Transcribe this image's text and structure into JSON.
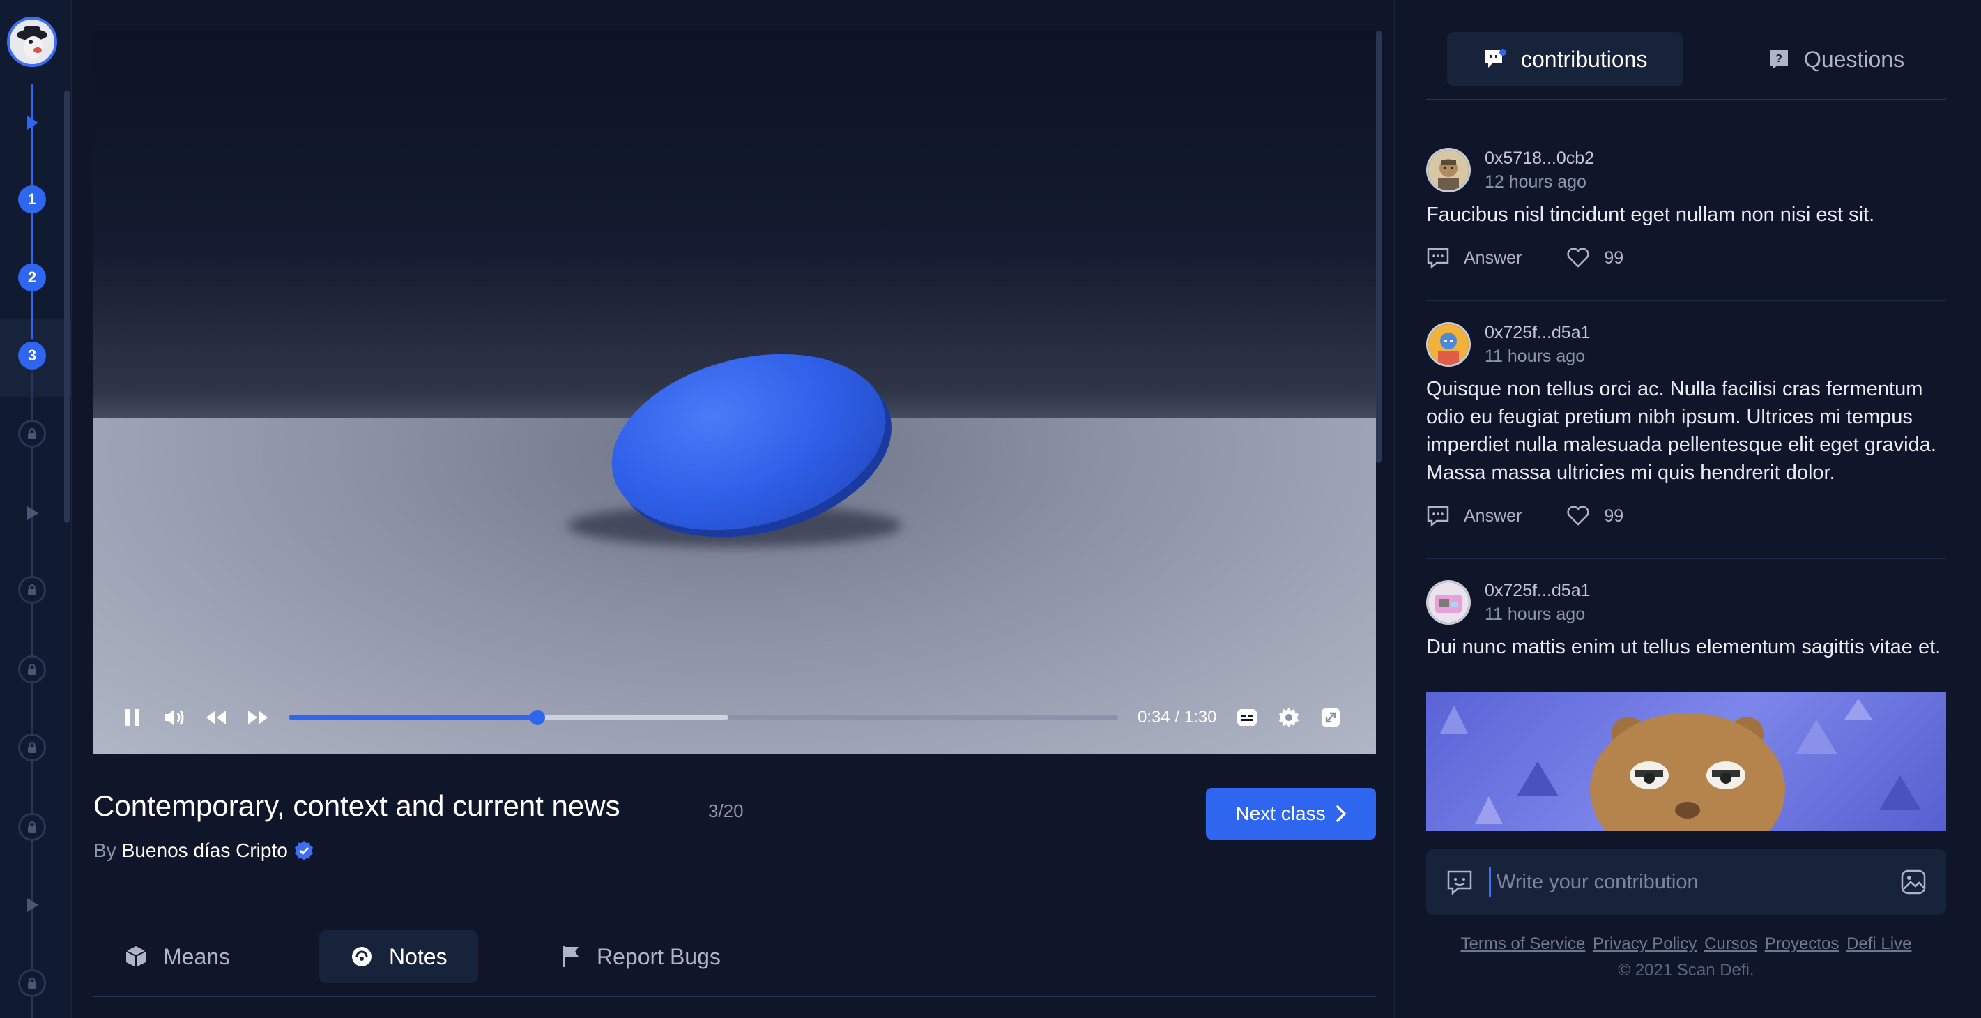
{
  "rail": {
    "nodes": [
      "1",
      "2",
      "3"
    ]
  },
  "player": {
    "time": "0:34 / 1:30",
    "progress": 0.3,
    "buffered": 0.53
  },
  "lesson": {
    "title": "Contemporary, context and current news",
    "counter": "3/20",
    "by_prefix": "By",
    "author": "Buenos días Cripto",
    "next_label": "Next class"
  },
  "tabs": {
    "means": "Means",
    "notes": "Notes",
    "report": "Report Bugs"
  },
  "panel": {
    "tab_contributions": "contributions",
    "tab_questions": "Questions",
    "posts": [
      {
        "user": "0x5718...0cb2",
        "time": "12 hours ago",
        "text": "Faucibus nisl tincidunt eget nullam non nisi est sit.",
        "answer": "Answer",
        "likes": "99"
      },
      {
        "user": "0x725f...d5a1",
        "time": "11  hours ago",
        "text": "Quisque non tellus orci ac. Nulla facilisi cras fermentum odio eu feugiat pretium nibh ipsum. Ultrices mi tempus imperdiet nulla malesuada pellentesque elit eget gravida. Massa massa ultricies mi quis hendrerit dolor.",
        "answer": "Answer",
        "likes": "99"
      },
      {
        "user": "0x725f...d5a1",
        "time": "11  hours ago",
        "text": "Dui nunc mattis enim ut tellus elementum sagittis vitae et."
      }
    ],
    "compose_placeholder": "Write your contribution"
  },
  "footer": {
    "links": [
      "Terms of Service",
      "Privacy Policy",
      "Cursos",
      "Proyectos",
      "Defi Live"
    ],
    "copyright": "© 2021 Scan Defi."
  },
  "colors": {
    "accent": "#2f66f0",
    "background": "#0f1629",
    "panel": "#17223b"
  }
}
